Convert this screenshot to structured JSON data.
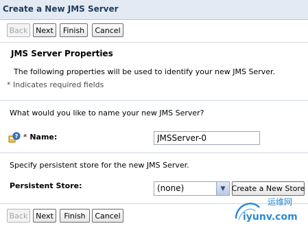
{
  "window": {
    "title": "Create a New JMS Server"
  },
  "buttons": {
    "back": "Back",
    "next": "Next",
    "finish": "Finish",
    "cancel": "Cancel"
  },
  "section": {
    "title": "JMS Server Properties",
    "description": "The following properties will be used to identify your new JMS Server.",
    "required_note": "* Indicates required fields"
  },
  "name_field": {
    "question": "What would you like to name your new JMS Server?",
    "required_mark": "*",
    "label": "Name:",
    "value": "JMSServer-0"
  },
  "store": {
    "description": "Specify persistent store for the new JMS Server.",
    "label": "Persistent Store:",
    "selected": "(none)",
    "create_button": "Create a New Store"
  },
  "watermark": {
    "text_cn": "运维网",
    "text_en": "iyunv.com"
  },
  "colors": {
    "title_bar": "#e3eaf3",
    "title_text": "#1f3b5a",
    "watermark": "#2b8ad1"
  }
}
